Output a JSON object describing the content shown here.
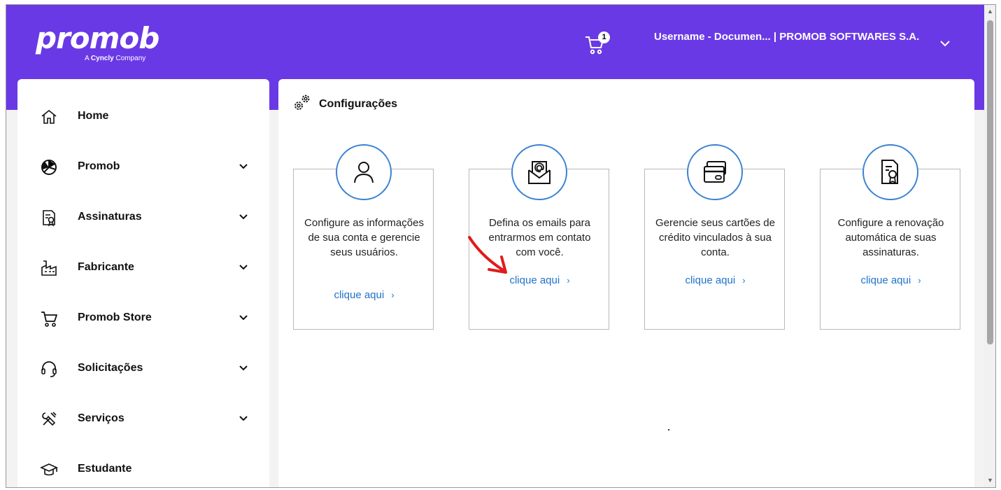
{
  "header": {
    "logo": {
      "name": "promob",
      "tagline_prefix": "A",
      "tagline_brand": "Cyncly",
      "tagline_suffix": "Company"
    },
    "cart": {
      "count": "1",
      "icon": "cart-icon"
    },
    "user": {
      "label": "Username - Documen... | PROMOB SOFTWARES S.A.",
      "icon": "chevron-down-icon"
    }
  },
  "sidebar": {
    "items": [
      {
        "label": "Home",
        "icon": "home-icon"
      },
      {
        "label": "Promob",
        "icon": "promob-icon"
      },
      {
        "label": "Assinaturas",
        "icon": "certificate-icon"
      },
      {
        "label": "Fabricante",
        "icon": "factory-icon"
      },
      {
        "label": "Promob Store",
        "icon": "cart-icon"
      },
      {
        "label": "Solicitações",
        "icon": "headset-icon"
      },
      {
        "label": "Serviços",
        "icon": "tools-icon"
      },
      {
        "label": "Estudante",
        "icon": "graduation-cap-icon"
      }
    ]
  },
  "main": {
    "title": "Configurações",
    "title_icon": "gears-icon",
    "cards": [
      {
        "text": "Configure as informações de sua conta e gerencie seus usuários.",
        "link": "clique aqui",
        "icon": "user-icon"
      },
      {
        "text": "Defina os emails para entrarmos em contato com você.",
        "link": "clique aqui",
        "icon": "email-icon"
      },
      {
        "text": "Gerencie seus cartões de crédito vinculados à sua conta.",
        "link": "clique aqui",
        "icon": "credit-card-icon"
      },
      {
        "text": "Configure a renovação automática de suas assinaturas.",
        "link": "clique aqui",
        "icon": "certificate-icon"
      }
    ]
  },
  "colors": {
    "header": "#6a39e6",
    "accent": "#3b82d4",
    "link": "#1f73c7",
    "annotation": "#e11b1b"
  }
}
